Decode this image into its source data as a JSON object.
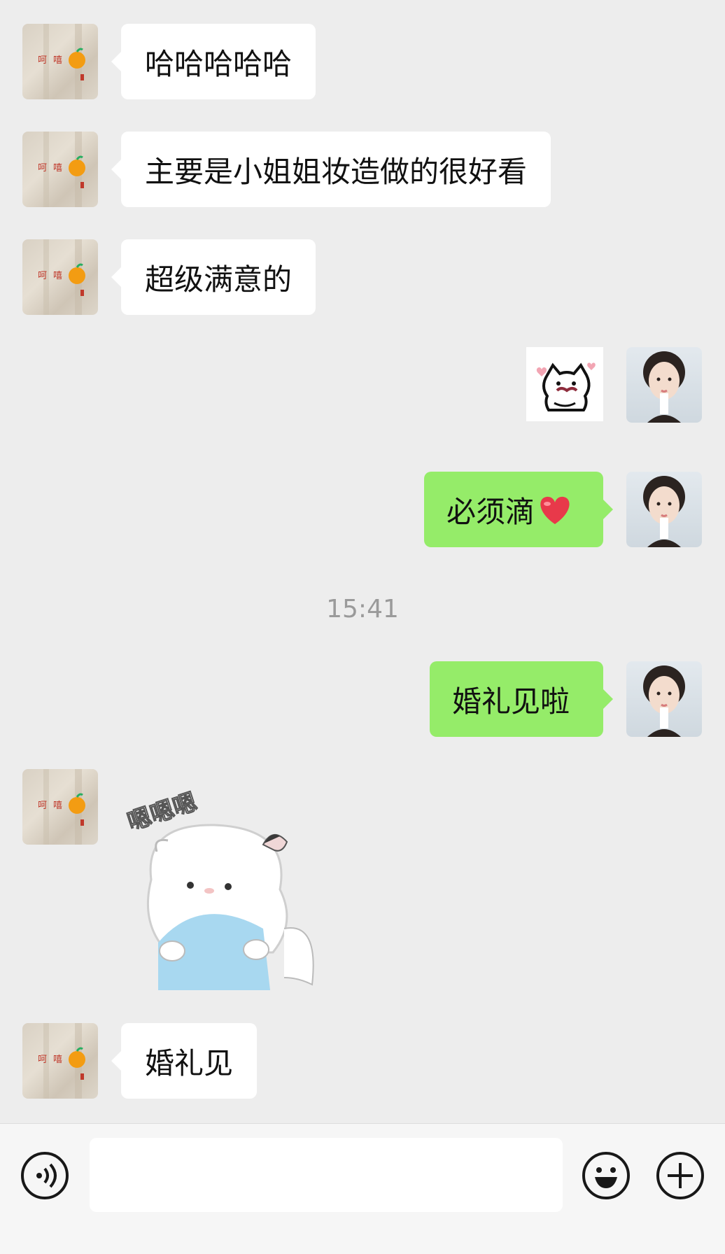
{
  "messages": [
    {
      "from": "them",
      "type": "text",
      "text": "哈哈哈哈哈"
    },
    {
      "from": "them",
      "type": "text",
      "text": "主要是小姐姐妆造做的很好看"
    },
    {
      "from": "them",
      "type": "text",
      "text": "超级满意的"
    },
    {
      "from": "me",
      "type": "sticker",
      "sticker": "cat-heart-sticker"
    },
    {
      "from": "me",
      "type": "text",
      "text": "必须滴",
      "emoji": "heart"
    },
    {
      "from": "me",
      "type": "text",
      "text": "婚礼见啦"
    },
    {
      "from": "them",
      "type": "sticker",
      "sticker": "hamster-hug-sticker",
      "sticker_text": "嗯嗯嗯"
    },
    {
      "from": "them",
      "type": "text",
      "text": "婚礼见"
    }
  ],
  "timestamp": "15:41",
  "avatar_left": {
    "text_1": "呵",
    "text_2": "嘻",
    "text_3": "橘"
  },
  "input_bar": {
    "placeholder": "",
    "left_icon": "voice-icon",
    "right_icons": [
      "emoji-icon",
      "plus-icon"
    ]
  },
  "colors": {
    "background": "#ededed",
    "outgoing": "#95ec69",
    "incoming": "#ffffff"
  }
}
